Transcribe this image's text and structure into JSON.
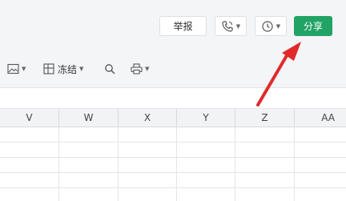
{
  "titlebar": {
    "report_label": "举报",
    "share_label": "分享",
    "phone_icon": "phone-sync-icon",
    "clock_icon": "clock-history-icon"
  },
  "toolbar": {
    "image_icon": "image-icon",
    "freeze_label": "冻结",
    "search_icon": "search-icon",
    "print_icon": "printer-icon"
  },
  "columns": [
    "V",
    "W",
    "X",
    "Y",
    "Z",
    "AA"
  ],
  "colors": {
    "share": "#21a366",
    "annotation_arrow": "#e02a2a"
  }
}
